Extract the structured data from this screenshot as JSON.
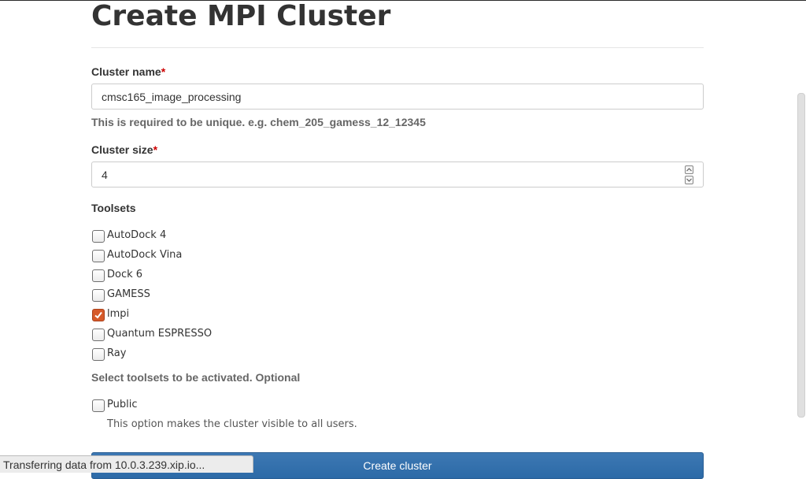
{
  "page": {
    "title": "Create MPI Cluster"
  },
  "form": {
    "cluster_name": {
      "label": "Cluster name",
      "required_mark": "*",
      "value": "cmsc165_image_processing",
      "help": "This is required to be unique. e.g. chem_205_gamess_12_12345"
    },
    "cluster_size": {
      "label": "Cluster size",
      "required_mark": "*",
      "value": "4"
    },
    "toolsets": {
      "label": "Toolsets",
      "options": [
        {
          "label": "AutoDock 4",
          "checked": false
        },
        {
          "label": "AutoDock Vina",
          "checked": false
        },
        {
          "label": "Dock 6",
          "checked": false
        },
        {
          "label": "GAMESS",
          "checked": false
        },
        {
          "label": "lmpi",
          "checked": true
        },
        {
          "label": "Quantum ESPRESSO",
          "checked": false
        },
        {
          "label": "Ray",
          "checked": false
        }
      ],
      "help": "Select toolsets to be activated. Optional"
    },
    "public": {
      "label": "Public",
      "checked": false,
      "help": "This option makes the cluster visible to all users."
    },
    "submit_label": "Create cluster"
  },
  "browser": {
    "status_text": "Transferring data from 10.0.3.239.xip.io..."
  },
  "colors": {
    "accent": "#2c6aa7",
    "checkbox_checked": "#d65a2a",
    "required": "#cc0000"
  }
}
